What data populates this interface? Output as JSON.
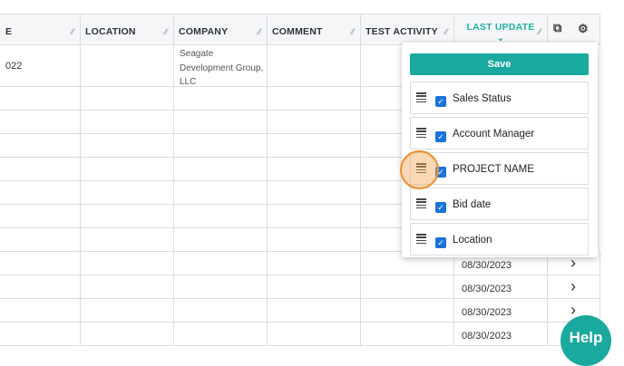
{
  "columns": [
    {
      "key": "e",
      "label": "E"
    },
    {
      "key": "location",
      "label": "LOCATION"
    },
    {
      "key": "company",
      "label": "COMPANY"
    },
    {
      "key": "comment",
      "label": "COMMENT"
    },
    {
      "key": "test_activity",
      "label": "TEST ACTIVITY"
    },
    {
      "key": "last_update",
      "label": "LAST UPDATE"
    }
  ],
  "rows": {
    "first": {
      "e": "022",
      "company_lines": [
        "Seagate",
        "Development Group,",
        "LLC"
      ]
    },
    "dates": [
      "08/30/2023",
      "08/30/2023",
      "08/30/2023",
      "08/30/2023"
    ]
  },
  "panel": {
    "save_label": "Save",
    "items": [
      {
        "label": "Sales Status",
        "checked": true
      },
      {
        "label": "Account Manager",
        "checked": true
      },
      {
        "label": "PROJECT NAME",
        "checked": true
      },
      {
        "label": "Bid date",
        "checked": true
      },
      {
        "label": "Location",
        "checked": true
      }
    ]
  },
  "help_label": "Help",
  "icons": {
    "export": "external-link-icon",
    "settings": "gear-icon",
    "row_arrow": "chevron-right-icon",
    "drag": "drag-handle-icon",
    "check": "checkbox-icon"
  },
  "colors": {
    "accent": "#1aa99e",
    "checkbox": "#1a73d9",
    "highlight": "#f08c2e"
  }
}
